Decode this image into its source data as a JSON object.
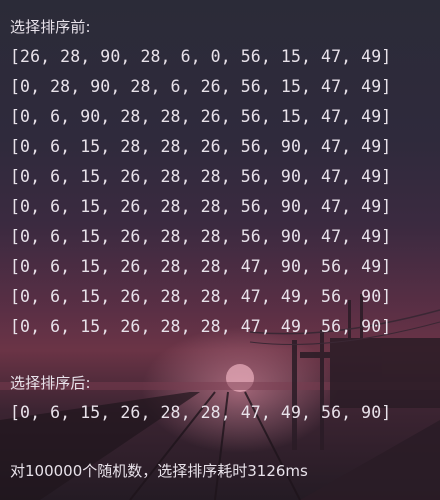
{
  "console": {
    "before_label": "选择排序前:",
    "passes": [
      "[26, 28, 90, 28, 6, 0, 56, 15, 47, 49]",
      "[0, 28, 90, 28, 6, 26, 56, 15, 47, 49]",
      "[0, 6, 90, 28, 28, 26, 56, 15, 47, 49]",
      "[0, 6, 15, 28, 28, 26, 56, 90, 47, 49]",
      "[0, 6, 15, 26, 28, 28, 56, 90, 47, 49]",
      "[0, 6, 15, 26, 28, 28, 56, 90, 47, 49]",
      "[0, 6, 15, 26, 28, 28, 56, 90, 47, 49]",
      "[0, 6, 15, 26, 28, 28, 47, 90, 56, 49]",
      "[0, 6, 15, 26, 28, 28, 47, 49, 56, 90]",
      "[0, 6, 15, 26, 28, 28, 47, 49, 56, 90]"
    ],
    "after_label": "选择排序后:",
    "result": "[0, 6, 15, 26, 28, 28, 47, 49, 56, 90]",
    "timing": "对100000个随机数，选择排序耗时3126ms"
  },
  "colors": {
    "text": "#e8e2ea",
    "sky_top": "#2b2b38",
    "horizon": "#6b3446",
    "ground": "#241b24"
  }
}
